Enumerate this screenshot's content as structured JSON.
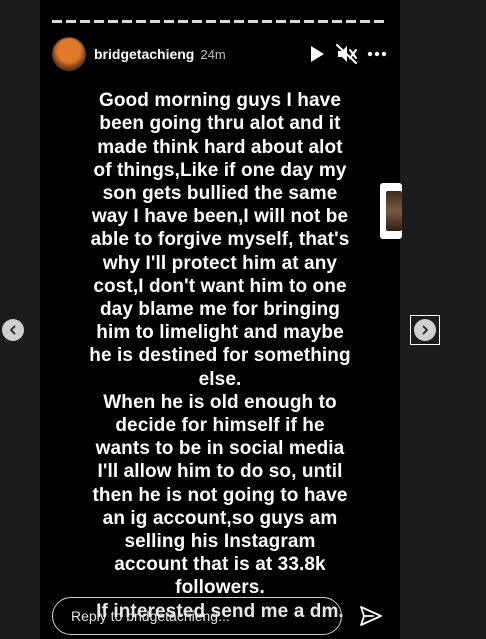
{
  "story": {
    "username": "bridgetachieng",
    "time": "24m",
    "text": "Good morning guys I have\nbeen going thru alot and it\nmade think hard about alot\nof things,Like if one day my\nson gets bullied the same\nway I have been,I will not be\nable to forgive myself, that's\nwhy I'll protect him at any\ncost,I don't want him to one\nday blame me for bringing\nhim to limelight and maybe\nhe is destined for something\nelse.\nWhen he is old enough to\ndecide for himself if he\nwants to be in social media\nI'll allow him to do so, until\nthen he is not going to have\nan ig account,so guys am\nselling his Instagram\naccount that is at 33.8k\nfollowers.",
    "last_line": "If interested send me a dm."
  },
  "reply": {
    "placeholder": "Reply to bridgetachieng..."
  },
  "icons": {
    "play": "play-icon",
    "mute": "speaker-muted-icon",
    "more": "more-icon",
    "send": "send-icon",
    "prev": "chevron-left-icon",
    "next": "chevron-right-icon"
  }
}
